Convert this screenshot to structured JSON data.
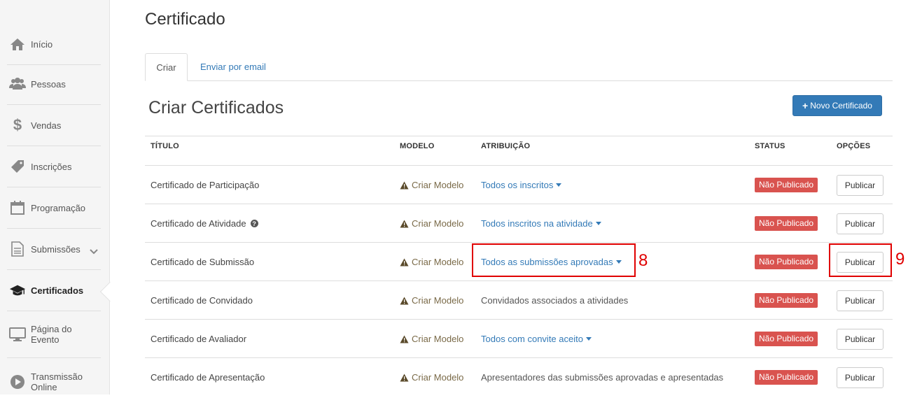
{
  "sidebar": {
    "items": [
      {
        "label": "Início",
        "icon": "home-icon"
      },
      {
        "label": "Pessoas",
        "icon": "users-icon"
      },
      {
        "label": "Vendas",
        "icon": "dollar-icon"
      },
      {
        "label": "Inscrições",
        "icon": "ticket-icon"
      },
      {
        "label": "Programação",
        "icon": "calendar-icon"
      },
      {
        "label": "Submissões",
        "icon": "document-icon"
      },
      {
        "label": "Certificados",
        "icon": "graduation-cap-icon"
      },
      {
        "label": "Página do Evento",
        "icon": "monitor-icon"
      },
      {
        "label": "Transmissão Online",
        "icon": "play-icon"
      }
    ],
    "active": "Certificados"
  },
  "header": {
    "title": "Certificado"
  },
  "tabs": [
    {
      "label": "Criar",
      "active": true
    },
    {
      "label": "Enviar por email",
      "active": false
    }
  ],
  "section": {
    "title": "Criar Certificados",
    "new_button": "Novo Certificado",
    "new_button_icon": "+"
  },
  "table": {
    "headers": {
      "title": "TÍTULO",
      "model": "MODELO",
      "attribution": "ATRIBUIÇÃO",
      "status": "STATUS",
      "options": "OPÇÕES"
    },
    "rows": [
      {
        "title": "Certificado de Participação",
        "model": "Criar Modelo",
        "attribution": "Todos os inscritos",
        "attribution_dropdown": true,
        "status": "Não Publicado",
        "action": "Publicar"
      },
      {
        "title": "Certificado de Atividade",
        "model": "Criar Modelo",
        "attribution": "Todos inscritos na atividade",
        "attribution_dropdown": true,
        "status": "Não Publicado",
        "action": "Publicar"
      },
      {
        "title": "Certificado de Submissão",
        "model": "Criar Modelo",
        "attribution": "Todos as submissões aprovadas",
        "attribution_dropdown": true,
        "status": "Não Publicado",
        "action": "Publicar"
      },
      {
        "title": "Certificado de Convidado",
        "model": "Criar Modelo",
        "attribution": "Convidados associados a atividades",
        "attribution_dropdown": false,
        "status": "Não Publicado",
        "action": "Publicar"
      },
      {
        "title": "Certificado de Avaliador",
        "model": "Criar Modelo",
        "attribution": "Todos com convite aceito",
        "attribution_dropdown": true,
        "status": "Não Publicado",
        "action": "Publicar"
      },
      {
        "title": "Certificado de Apresentação",
        "model": "Criar Modelo",
        "attribution": "Apresentadores das submissões aprovadas e apresentadas",
        "attribution_dropdown": false,
        "status": "Não Publicado",
        "action": "Publicar"
      }
    ]
  },
  "annotations": [
    {
      "label": "8",
      "color": "#e00000"
    },
    {
      "label": "9",
      "color": "#e00000"
    }
  ],
  "colors": {
    "primary": "#337ab7",
    "danger": "#d9534f",
    "annotation": "#e00000"
  }
}
